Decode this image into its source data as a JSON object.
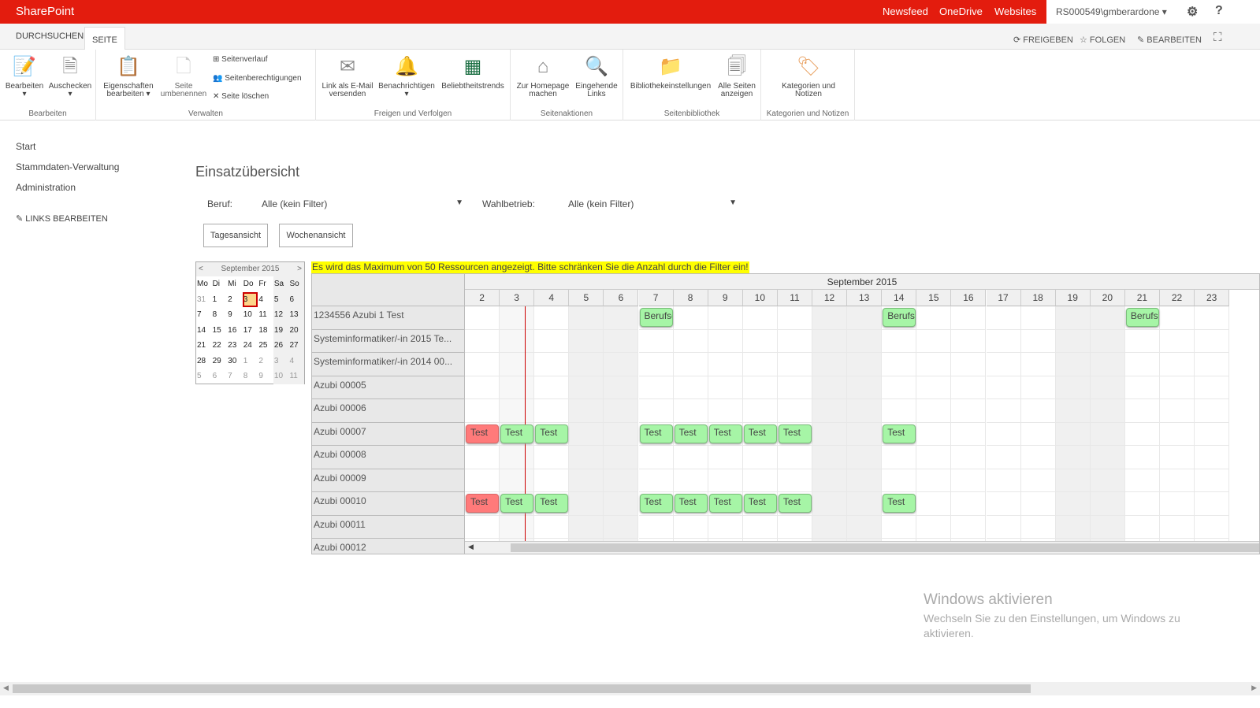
{
  "topbar": {
    "brand": "SharePoint",
    "nav": [
      "Newsfeed",
      "OneDrive",
      "Websites"
    ],
    "user": "RS000549\\gmberardone ▾",
    "brand_color": "#e31c0e"
  },
  "tabs": {
    "items": [
      "DURCHSUCHEN",
      "SEITE"
    ],
    "actions": [
      "FREIGEBEN",
      "FOLGEN",
      "BEARBEITEN"
    ]
  },
  "ribbon": {
    "groups": [
      {
        "label": "Bearbeiten",
        "buttons": [
          "Bearbeiten",
          "Auschecken"
        ]
      },
      {
        "label": "Verwalten",
        "buttons": [
          "Eigenschaften bearbeiten",
          "Seite umbenennen"
        ],
        "small": [
          "Seitenverlauf",
          "Seitenberechtigungen",
          "Seite löschen"
        ]
      },
      {
        "label": "Freigen und Verfolgen",
        "buttons": [
          "Link als E-Mail versenden",
          "Benachrichtigen",
          "Beliebtheitstrends"
        ]
      },
      {
        "label": "Seitenaktionen",
        "buttons": [
          "Zur Homepage machen",
          "Eingehende Links"
        ]
      },
      {
        "label": "Seitenbibliothek",
        "buttons": [
          "Bibliothekeinstellungen",
          "Alle Seiten anzeigen"
        ]
      },
      {
        "label": "Kategorien und Notizen",
        "buttons": [
          "Kategorien und Notizen"
        ]
      }
    ]
  },
  "leftnav": {
    "items": [
      "Start",
      "Stammdaten-Verwaltung",
      "Administration"
    ],
    "edit_links": "LINKS BEARBEITEN"
  },
  "page": {
    "title": "Einsatzübersicht",
    "filters": {
      "beruf_label": "Beruf:",
      "beruf_value": "Alle (kein Filter)",
      "wahl_label": "Wahlbetrieb:",
      "wahl_value": "Alle (kein Filter)"
    },
    "buttons": {
      "day": "Tagesansicht",
      "week": "Wochenansicht"
    },
    "warning": "Es wird das Maximum von 50 Ressourcen angezeigt. Bitte schränken Sie die Anzahl durch die Filter ein!"
  },
  "calendar": {
    "title": "September 2015",
    "prev": "<",
    "next": ">",
    "weekdays": [
      "Mo",
      "Di",
      "Mi",
      "Do",
      "Fr",
      "Sa",
      "So"
    ],
    "weeks": [
      [
        "31",
        "1",
        "2",
        "3",
        "4",
        "5",
        "6"
      ],
      [
        "7",
        "8",
        "9",
        "10",
        "11",
        "12",
        "13"
      ],
      [
        "14",
        "15",
        "16",
        "17",
        "18",
        "19",
        "20"
      ],
      [
        "21",
        "22",
        "23",
        "24",
        "25",
        "26",
        "27"
      ],
      [
        "28",
        "29",
        "30",
        "1",
        "2",
        "3",
        "4"
      ],
      [
        "5",
        "6",
        "7",
        "8",
        "9",
        "10",
        "11"
      ]
    ],
    "selected": "3"
  },
  "scheduler": {
    "month": "September 2015",
    "days": [
      "2",
      "3",
      "4",
      "5",
      "6",
      "7",
      "8",
      "9",
      "10",
      "11",
      "12",
      "13",
      "14",
      "15",
      "16",
      "17",
      "18",
      "19",
      "20",
      "21",
      "22",
      "23"
    ],
    "weekend_days": [
      "5",
      "6",
      "12",
      "13",
      "19",
      "20"
    ],
    "resources": [
      "1234556 Azubi 1 Test",
      "Systeminformatiker/-in 2015 Te...",
      "Systeminformatiker/-in 2014 00...",
      "Azubi 00005",
      "Azubi 00006",
      "Azubi 00007",
      "Azubi 00008",
      "Azubi 00009",
      "Azubi 00010",
      "Azubi 00011",
      "Azubi 00012"
    ],
    "events": [
      {
        "row": 0,
        "day": "7",
        "label": "Berufsc",
        "color": "green"
      },
      {
        "row": 0,
        "day": "14",
        "label": "Berufsc",
        "color": "green"
      },
      {
        "row": 0,
        "day": "21",
        "label": "Berufsc",
        "color": "green"
      },
      {
        "row": 5,
        "day": "2",
        "label": "Test",
        "color": "red"
      },
      {
        "row": 5,
        "day": "3",
        "label": "Test",
        "color": "green"
      },
      {
        "row": 5,
        "day": "4",
        "label": "Test",
        "color": "green"
      },
      {
        "row": 5,
        "day": "7",
        "label": "Test",
        "color": "green"
      },
      {
        "row": 5,
        "day": "8",
        "label": "Test",
        "color": "green"
      },
      {
        "row": 5,
        "day": "9",
        "label": "Test",
        "color": "green"
      },
      {
        "row": 5,
        "day": "10",
        "label": "Test",
        "color": "green"
      },
      {
        "row": 5,
        "day": "11",
        "label": "Test",
        "color": "green"
      },
      {
        "row": 5,
        "day": "14",
        "label": "Test",
        "color": "green"
      },
      {
        "row": 8,
        "day": "2",
        "label": "Test",
        "color": "red"
      },
      {
        "row": 8,
        "day": "3",
        "label": "Test",
        "color": "green"
      },
      {
        "row": 8,
        "day": "4",
        "label": "Test",
        "color": "green"
      },
      {
        "row": 8,
        "day": "7",
        "label": "Test",
        "color": "green"
      },
      {
        "row": 8,
        "day": "8",
        "label": "Test",
        "color": "green"
      },
      {
        "row": 8,
        "day": "9",
        "label": "Test",
        "color": "green"
      },
      {
        "row": 8,
        "day": "10",
        "label": "Test",
        "color": "green"
      },
      {
        "row": 8,
        "day": "11",
        "label": "Test",
        "color": "green"
      },
      {
        "row": 8,
        "day": "14",
        "label": "Test",
        "color": "green"
      }
    ]
  },
  "watermark": {
    "title": "Windows aktivieren",
    "text": "Wechseln Sie zu den Einstellungen, um Windows zu aktivieren."
  }
}
